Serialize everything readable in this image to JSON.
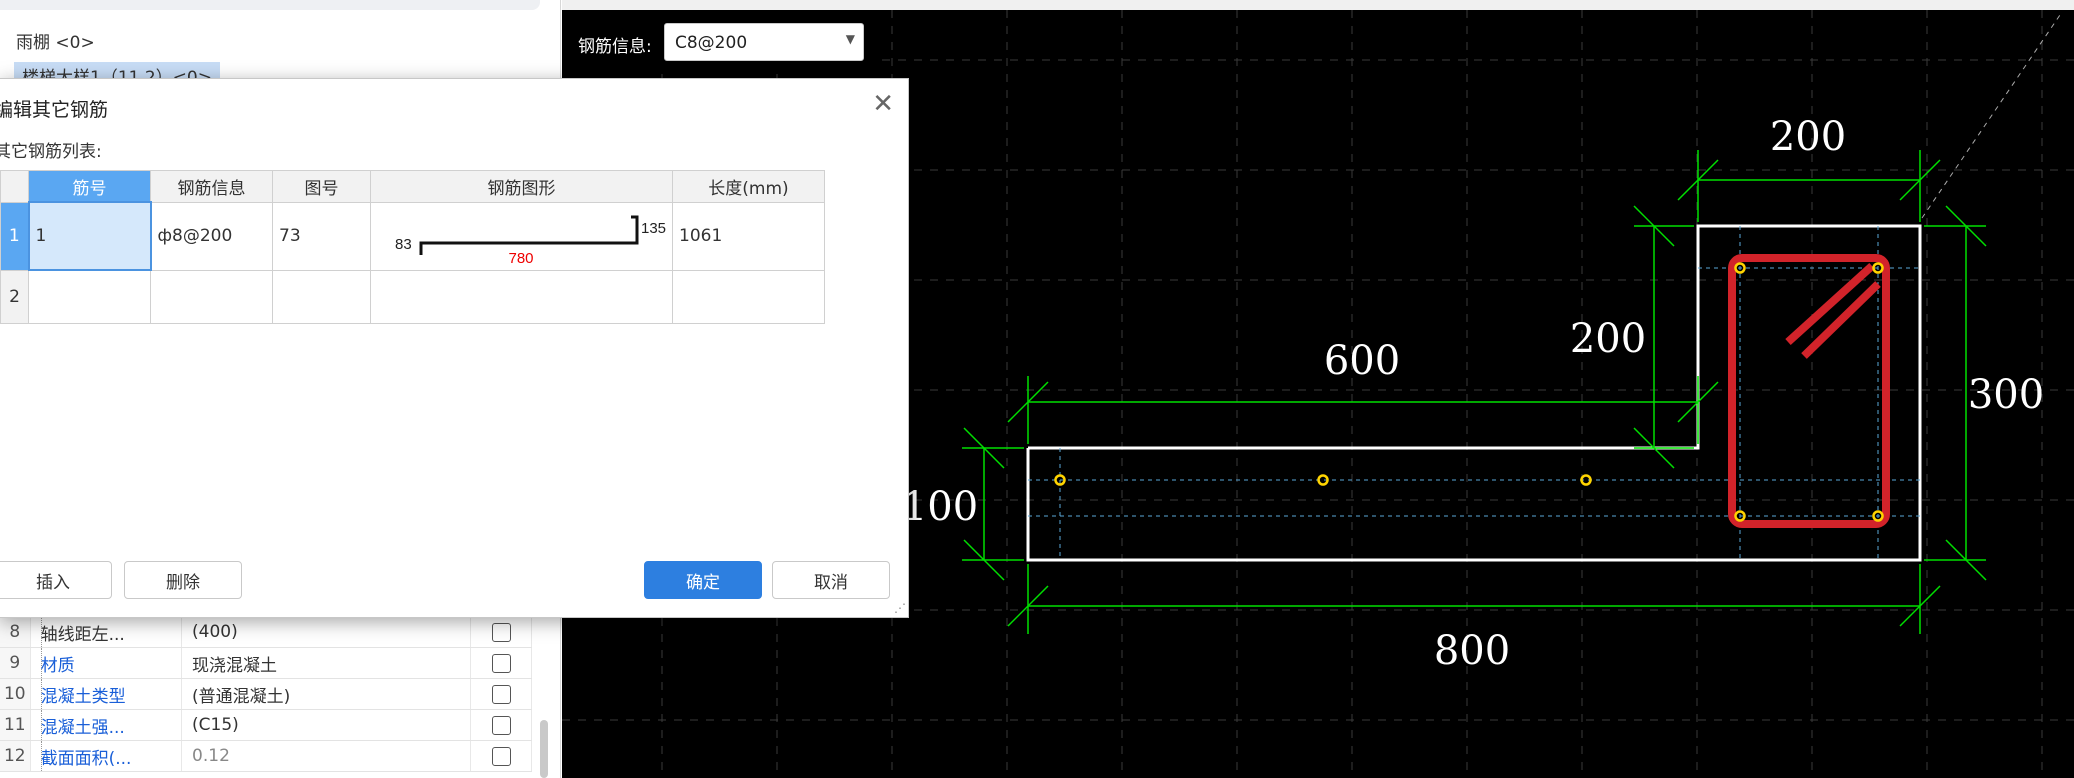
{
  "left_panel": {
    "tree_items": [
      "雨棚 <0>",
      "楼梯大样1（11.2）<0>"
    ],
    "property_rows": [
      {
        "num": "8",
        "name": "轴线距左...",
        "value": "(400)",
        "gray": false
      },
      {
        "num": "9",
        "name": "材质",
        "value": "现浇混凝土",
        "gray": false
      },
      {
        "num": "10",
        "name": "混凝土类型",
        "value": "(普通混凝土)",
        "gray": false
      },
      {
        "num": "11",
        "name": "混凝土强...",
        "value": "(C15)",
        "gray": false
      },
      {
        "num": "12",
        "name": "截面面积(...",
        "value": "0.12",
        "gray": true
      }
    ]
  },
  "canvas": {
    "rebar_info_label": "钢筋信息:",
    "rebar_info_value": "C8@200",
    "dimensions": {
      "top": "200",
      "left_step": "200",
      "flange_width": "600",
      "right_height": "300",
      "left_height": "100",
      "bottom": "800"
    },
    "colors": {
      "background": "#000000",
      "outline": "#ffffff",
      "dimension": "#00ff00",
      "rebar": "#d2232a",
      "point": "#ffd400",
      "grid": "#3a3a3a"
    }
  },
  "dialog": {
    "title": "编辑其它钢筋",
    "list_label": "其它钢筋列表:",
    "columns": [
      "筋号",
      "钢筋信息",
      "图号",
      "钢筋图形",
      "长度(mm)"
    ],
    "rows": [
      {
        "num": "1",
        "bar_no": "1",
        "info": "ф8@200",
        "fig_no": "73",
        "shape": {
          "left": "83",
          "middle": "780",
          "right": "135"
        },
        "length": "1061"
      },
      {
        "num": "2",
        "bar_no": "",
        "info": "",
        "fig_no": "",
        "shape": null,
        "length": ""
      }
    ],
    "buttons": {
      "insert": "插入",
      "delete": "删除",
      "ok": "确定",
      "cancel": "取消"
    }
  }
}
